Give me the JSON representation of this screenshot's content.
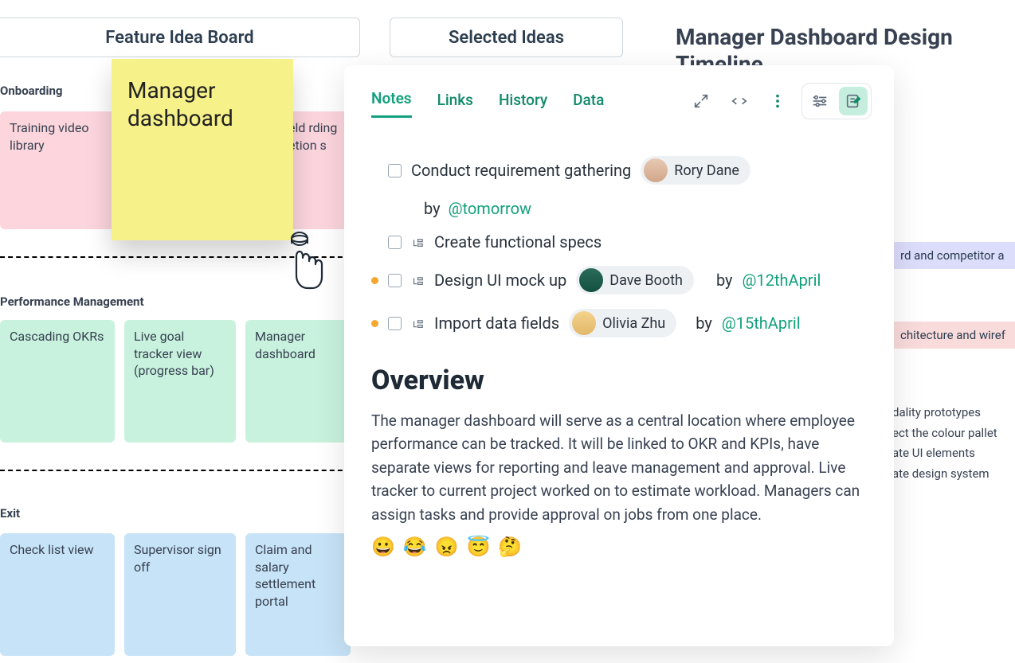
{
  "columns": {
    "feature_board": "Feature Idea Board",
    "selected_ideas": "Selected Ideas"
  },
  "page_title": "Manager Dashboard Design Timeline",
  "sections": {
    "onboarding": "Onboarding",
    "performance": "Performance Management",
    "exit": "Exit"
  },
  "onboarding_cards": {
    "c1": "Training video library",
    "c2": "eld rding etion s"
  },
  "sticky": "Manager dashboard",
  "perf_cards": {
    "c1": "Cascading OKRs",
    "c2": "Live goal tracker view (progress bar)",
    "c3": "Manager dashboard"
  },
  "exit_cards": {
    "c1": "Check list view",
    "c2": "Supervisor sign off",
    "c3": "Claim and salary settlement portal"
  },
  "timeline": {
    "t1": "rd and competitor a",
    "t2": "chitecture and wiref",
    "list": [
      "dality prototypes",
      "ect the colour pallet",
      "ate UI elements",
      "ate design system"
    ]
  },
  "panel": {
    "tabs": {
      "notes": "Notes",
      "links": "Links",
      "history": "History",
      "data": "Data"
    },
    "tasks": [
      {
        "text": "Conduct requirement gathering",
        "assignee": "Rory Dane",
        "by": "by",
        "at": "@tomorrow",
        "bullet": false,
        "sub": false
      },
      {
        "text": "Create functional specs",
        "bullet": false,
        "sub": true
      },
      {
        "text": "Design UI mock up",
        "assignee": "Dave Booth",
        "by": "by",
        "at": "@12thApril",
        "bullet": true,
        "sub": true
      },
      {
        "text": "Import data fields",
        "assignee": "Olivia Zhu",
        "by": "by",
        "at": "@15thApril",
        "bullet": true,
        "sub": true
      }
    ],
    "overview_h": "Overview",
    "overview_p": "The manager dashboard will serve as a central location where employee performance can be tracked. It will be linked to OKR and KPIs, have separate views for reporting and leave management and approval.  Live tracker to current project worked on to estimate workload. Managers can assign tasks and provide approval on jobs from one place.",
    "emojis": "😀 😂 😠 😇 🤔"
  }
}
